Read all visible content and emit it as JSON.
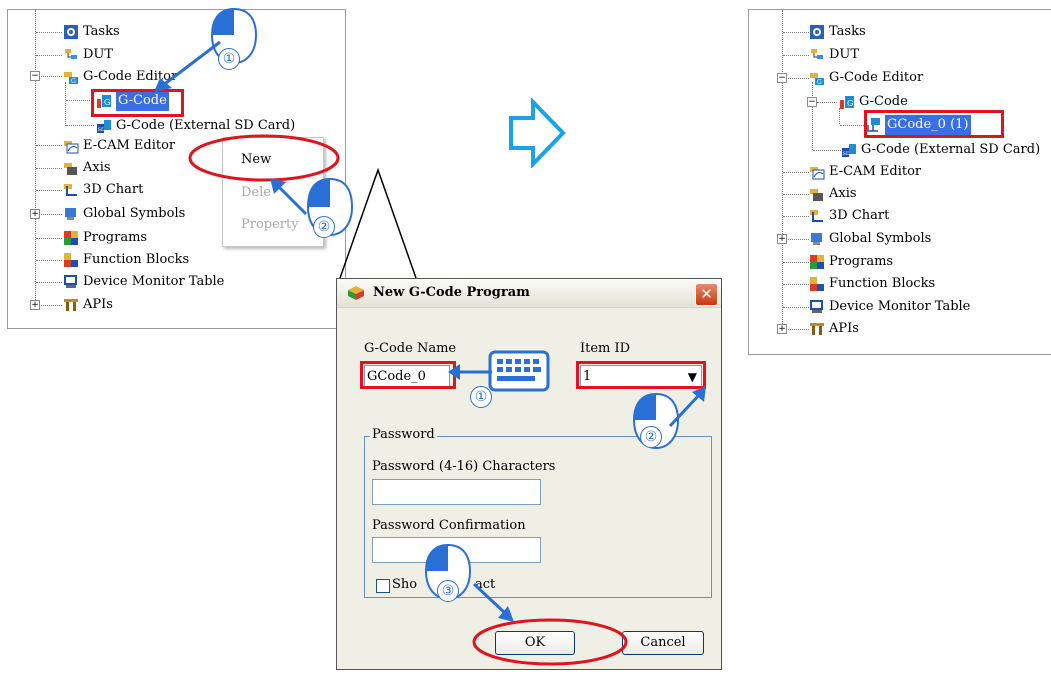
{
  "left_tree": {
    "items": [
      {
        "label": "Tasks",
        "icon": "tasks-icon"
      },
      {
        "label": "DUT",
        "icon": "dut-icon"
      },
      {
        "label": "G-Code Editor",
        "icon": "gcode-editor-icon"
      },
      {
        "label": "G-Code",
        "icon": "gcode-icon"
      },
      {
        "label": "G-Code (External SD Card)",
        "icon": "sd-card-icon"
      },
      {
        "label": "E-CAM Editor",
        "icon": "ecam-editor-icon"
      },
      {
        "label": "Axis",
        "icon": "axis-icon"
      },
      {
        "label": "3D Chart",
        "icon": "chart-3d-icon"
      },
      {
        "label": "Global Symbols",
        "icon": "global-symbols-icon"
      },
      {
        "label": "Programs",
        "icon": "programs-icon"
      },
      {
        "label": "Function Blocks",
        "icon": "function-blocks-icon"
      },
      {
        "label": "Device Monitor Table",
        "icon": "device-monitor-icon"
      },
      {
        "label": "APIs",
        "icon": "apis-icon"
      }
    ]
  },
  "context_menu": {
    "items": [
      "New",
      "Dele",
      "Property"
    ]
  },
  "callouts": {
    "left_one": "①",
    "left_two": "②",
    "dialog_one": "①",
    "dialog_two": "②",
    "dialog_three": "③"
  },
  "dialog": {
    "title": "New G-Code Program",
    "close": "✕",
    "gcode_name_label": "G-Code Name",
    "gcode_name_value": "GCode_0",
    "item_id_label": "Item ID",
    "item_id_value": "1",
    "password_group": "Password",
    "password_label": "Password (4-16) Characters",
    "password_value": "",
    "confirm_label": "Password Confirmation",
    "confirm_value": "",
    "show_text": "Sho",
    "show_text_tail": "act",
    "ok": "OK",
    "cancel": "Cancel"
  },
  "right_tree": {
    "items": [
      {
        "label": "Tasks",
        "icon": "tasks-icon"
      },
      {
        "label": "DUT",
        "icon": "dut-icon"
      },
      {
        "label": "G-Code Editor",
        "icon": "gcode-editor-icon"
      },
      {
        "label": "G-Code",
        "icon": "gcode-icon"
      },
      {
        "label": "GCode_0 (1)",
        "icon": "gcode-program-icon"
      },
      {
        "label": "G-Code (External SD Card)",
        "icon": "sd-card-icon"
      },
      {
        "label": "E-CAM Editor",
        "icon": "ecam-editor-icon"
      },
      {
        "label": "Axis",
        "icon": "axis-icon"
      },
      {
        "label": "3D Chart",
        "icon": "chart-3d-icon"
      },
      {
        "label": "Global Symbols",
        "icon": "global-symbols-icon"
      },
      {
        "label": "Programs",
        "icon": "programs-icon"
      },
      {
        "label": "Function Blocks",
        "icon": "function-blocks-icon"
      },
      {
        "label": "Device Monitor Table",
        "icon": "device-monitor-icon"
      },
      {
        "label": "APIs",
        "icon": "apis-icon"
      }
    ]
  },
  "colors": {
    "highlight": "#e0141e",
    "accent": "#2a6fd6",
    "selection": "#3a6ee8"
  }
}
